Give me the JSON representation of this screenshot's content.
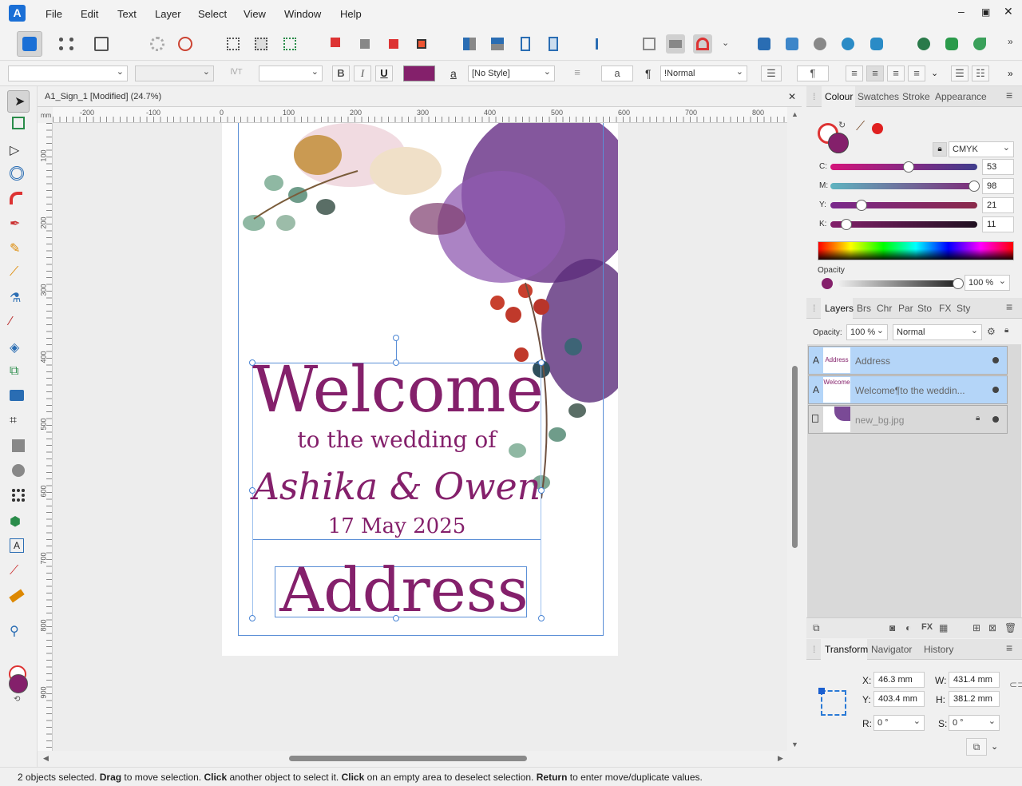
{
  "menu": {
    "items": [
      "File",
      "Edit",
      "Text",
      "Layer",
      "Select",
      "View",
      "Window",
      "Help"
    ],
    "window_controls": [
      "–",
      "▣",
      "✕"
    ]
  },
  "context_bar": {
    "font_family": "",
    "font_style": "",
    "font_size": "",
    "bold": "B",
    "italic": "I",
    "underline": "U",
    "text_color": "#84206b",
    "a_glyph": "a",
    "text_style": "[No Style]",
    "para_a": "a",
    "pilcrow": "¶",
    "para_style": "!Normal",
    "pilcrow2": "¶"
  },
  "document": {
    "tab_title": "A1_Sign_1 [Modified] (24.7%)",
    "close": "✕",
    "ruler_unit": "mm",
    "h_ticks": [
      "-200",
      "-100",
      "0",
      "100",
      "200",
      "300",
      "400",
      "500",
      "600",
      "700",
      "800"
    ],
    "v_ticks": [
      "100",
      "200",
      "300",
      "400",
      "500",
      "600",
      "700",
      "800",
      "900"
    ]
  },
  "artwork": {
    "welcome": "Welcome",
    "subtitle": "to the wedding of",
    "names": "Ashika & Owen",
    "date": "17 May 2025",
    "address": "Address",
    "text_color": "#84206b"
  },
  "colour_panel": {
    "tabs": [
      "Colour",
      "Swatches",
      "Stroke",
      "Appearance"
    ],
    "model": "CMYK",
    "channels": [
      {
        "label": "C:",
        "value": "53",
        "fraction": 0.53
      },
      {
        "label": "M:",
        "value": "98",
        "fraction": 0.98
      },
      {
        "label": "Y:",
        "value": "21",
        "fraction": 0.21
      },
      {
        "label": "K:",
        "value": "11",
        "fraction": 0.11
      }
    ],
    "opacity_label": "Opacity",
    "opacity_value": "100 %",
    "fill_color": "#84206b",
    "picker_color": "#e02020"
  },
  "layers_panel": {
    "tabs": [
      "Layers",
      "Brs",
      "Chr",
      "Par",
      "Sto",
      "FX",
      "Sty"
    ],
    "opacity_label": "Opacity:",
    "opacity_value": "100 %",
    "blend_mode": "Normal",
    "layers": [
      {
        "type": "A",
        "name": "Address",
        "thumb": "Address",
        "selected": true,
        "locked": false
      },
      {
        "type": "A",
        "name": "Welcome¶to the weddin...",
        "thumb": "Welcome",
        "selected": true,
        "locked": false
      },
      {
        "type": "img",
        "name": "new_bg.jpg",
        "thumb": "",
        "selected": false,
        "locked": true
      }
    ]
  },
  "transform_panel": {
    "tabs": [
      "Transform",
      "Navigator",
      "History"
    ],
    "x_label": "X:",
    "x_value": "46.3 mm",
    "y_label": "Y:",
    "y_value": "403.4 mm",
    "w_label": "W:",
    "w_value": "431.4 mm",
    "h_label": "H:",
    "h_value": "381.2 mm",
    "r_label": "R:",
    "r_value": "0 °",
    "s_label": "S:",
    "s_value": "0 °"
  },
  "status": {
    "text_parts": [
      {
        "t": "2 objects selected. ",
        "b": false
      },
      {
        "t": "Drag",
        "b": true
      },
      {
        "t": " to move selection. ",
        "b": false
      },
      {
        "t": "Click",
        "b": true
      },
      {
        "t": " another object to select it. ",
        "b": false
      },
      {
        "t": "Click",
        "b": true
      },
      {
        "t": " on an empty area to deselect selection. ",
        "b": false
      },
      {
        "t": "Return",
        "b": true
      },
      {
        "t": " to enter move/duplicate values.",
        "b": false
      }
    ]
  }
}
